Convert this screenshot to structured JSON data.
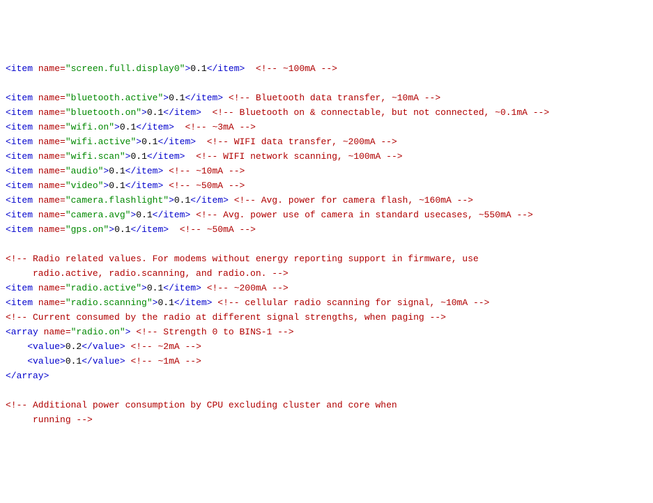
{
  "lines": [
    {
      "type": "item",
      "name": "screen.full.display0",
      "value": "0.1",
      "pad": "  ",
      "comment": "~100mA"
    },
    {
      "type": "blank"
    },
    {
      "type": "item",
      "name": "bluetooth.active",
      "value": "0.1",
      "pad": " ",
      "comment": "Bluetooth data transfer, ~10mA"
    },
    {
      "type": "item",
      "name": "bluetooth.on",
      "value": "0.1",
      "pad": "  ",
      "comment": "Bluetooth on & connectable, but not connected, ~0.1mA"
    },
    {
      "type": "item",
      "name": "wifi.on",
      "value": "0.1",
      "pad": "  ",
      "comment": "~3mA"
    },
    {
      "type": "item",
      "name": "wifi.active",
      "value": "0.1",
      "pad": "  ",
      "comment": "WIFI data transfer, ~200mA"
    },
    {
      "type": "item",
      "name": "wifi.scan",
      "value": "0.1",
      "pad": "  ",
      "comment": "WIFI network scanning, ~100mA"
    },
    {
      "type": "item",
      "name": "audio",
      "value": "0.1",
      "pad": " ",
      "comment": "~10mA"
    },
    {
      "type": "item",
      "name": "video",
      "value": "0.1",
      "pad": " ",
      "comment": "~50mA"
    },
    {
      "type": "item",
      "name": "camera.flashlight",
      "value": "0.1",
      "pad": " ",
      "comment": "Avg. power for camera flash, ~160mA"
    },
    {
      "type": "item",
      "name": "camera.avg",
      "value": "0.1",
      "pad": " ",
      "comment": "Avg. power use of camera in standard usecases, ~550mA"
    },
    {
      "type": "item",
      "name": "gps.on",
      "value": "0.1",
      "pad": "  ",
      "comment": "~50mA"
    },
    {
      "type": "blank"
    },
    {
      "type": "comment",
      "text": "Radio related values. For modems without energy reporting support in firmware, use"
    },
    {
      "type": "comment-cont",
      "text": "     radio.active, radio.scanning, and radio.on."
    },
    {
      "type": "item",
      "name": "radio.active",
      "value": "0.1",
      "pad": " ",
      "comment": "~200mA"
    },
    {
      "type": "item",
      "name": "radio.scanning",
      "value": "0.1",
      "pad": " ",
      "comment": "cellular radio scanning for signal, ~10mA"
    },
    {
      "type": "comment-inline",
      "text": "Current consumed by the radio at different signal strengths, when paging"
    },
    {
      "type": "array-open",
      "name": "radio.on",
      "comment": "Strength 0 to BINS-1"
    },
    {
      "type": "value",
      "value": "0.2",
      "comment": "~2mA"
    },
    {
      "type": "value",
      "value": "0.1",
      "comment": "~1mA"
    },
    {
      "type": "array-close"
    },
    {
      "type": "blank"
    },
    {
      "type": "comment",
      "text": "Additional power consumption by CPU excluding cluster and core when"
    },
    {
      "type": "comment-cont-open",
      "text": "     running"
    }
  ],
  "tokens": {
    "item_open": "<item",
    "item_close_tag": "</item>",
    "array_open": "<array",
    "array_close_tag": "</array>",
    "value_open": "<value>",
    "value_close": "</value>",
    "name_attr": " name=",
    "gt": ">",
    "cmt_open": "<!--",
    "cmt_close": "-->"
  }
}
